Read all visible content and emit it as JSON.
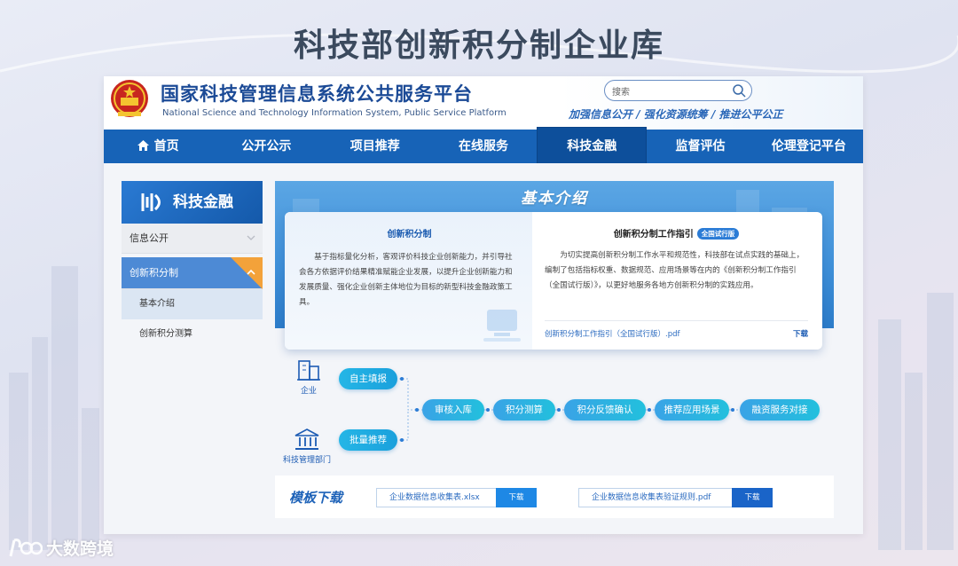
{
  "slide": {
    "title": "科技部创新积分制企业库"
  },
  "header": {
    "site_name": "国家科技管理信息系统公共服务平台",
    "site_name_en": "National Science and Technology Information System, Public Service Platform",
    "search_placeholder": "搜索",
    "slogan": "加强信息公开 / 强化资源统筹 / 推进公平公正"
  },
  "nav": {
    "items": [
      {
        "label": "首页"
      },
      {
        "label": "公开公示"
      },
      {
        "label": "项目推荐"
      },
      {
        "label": "在线服务"
      },
      {
        "label": "科技金融"
      },
      {
        "label": "监督评估"
      },
      {
        "label": "伦理登记平台"
      }
    ],
    "active_index": 4
  },
  "sidebar": {
    "title": "科技金融",
    "items": [
      {
        "label": "信息公开"
      },
      {
        "label": "创新积分制"
      }
    ],
    "sub_items": [
      {
        "label": "基本介绍"
      },
      {
        "label": "创新积分测算"
      }
    ]
  },
  "banner": {
    "title": "基本介绍"
  },
  "intro": {
    "left_title": "创新积分制",
    "left_text": "基于指标量化分析，客观评价科技企业创新能力，并引导社会各方依据评价结果精准赋能企业发展，以提升企业创新能力和发展质量、强化企业创新主体地位为目标的新型科技金融政策工具。",
    "right_title": "创新积分制工作指引",
    "right_tag": "全国试行版",
    "right_text": "为切实提高创新积分制工作水平和规范性，科技部在试点实践的基础上，编制了包括指标权重、数据规范、应用场景等在内的《创新积分制工作指引（全国试行版）》，以更好地服务各地方创新积分制的实践应用。",
    "file_name": "创新积分制工作指引（全国试行版）.pdf",
    "download_label": "下载"
  },
  "flow": {
    "actor_company": "企业",
    "actor_dept": "科技管理部门",
    "step_self": "自主填报",
    "step_batch": "批量推荐",
    "steps": [
      "审核入库",
      "积分测算",
      "积分反馈确认",
      "推荐应用场景",
      "融资服务对接"
    ]
  },
  "templates": {
    "title": "模板下载",
    "files": [
      {
        "name": "企业数据信息收集表.xlsx",
        "button": "下载"
      },
      {
        "name": "企业数据信息收集表验证规则.pdf",
        "button": "下载"
      }
    ]
  },
  "watermark": {
    "text": "大数跨境"
  },
  "colors": {
    "nav": "#1763b7",
    "nav_active": "#0d4f9b",
    "accent": "#1d62b8",
    "pill": "#22c0dd",
    "orange": "#f3a23a"
  }
}
